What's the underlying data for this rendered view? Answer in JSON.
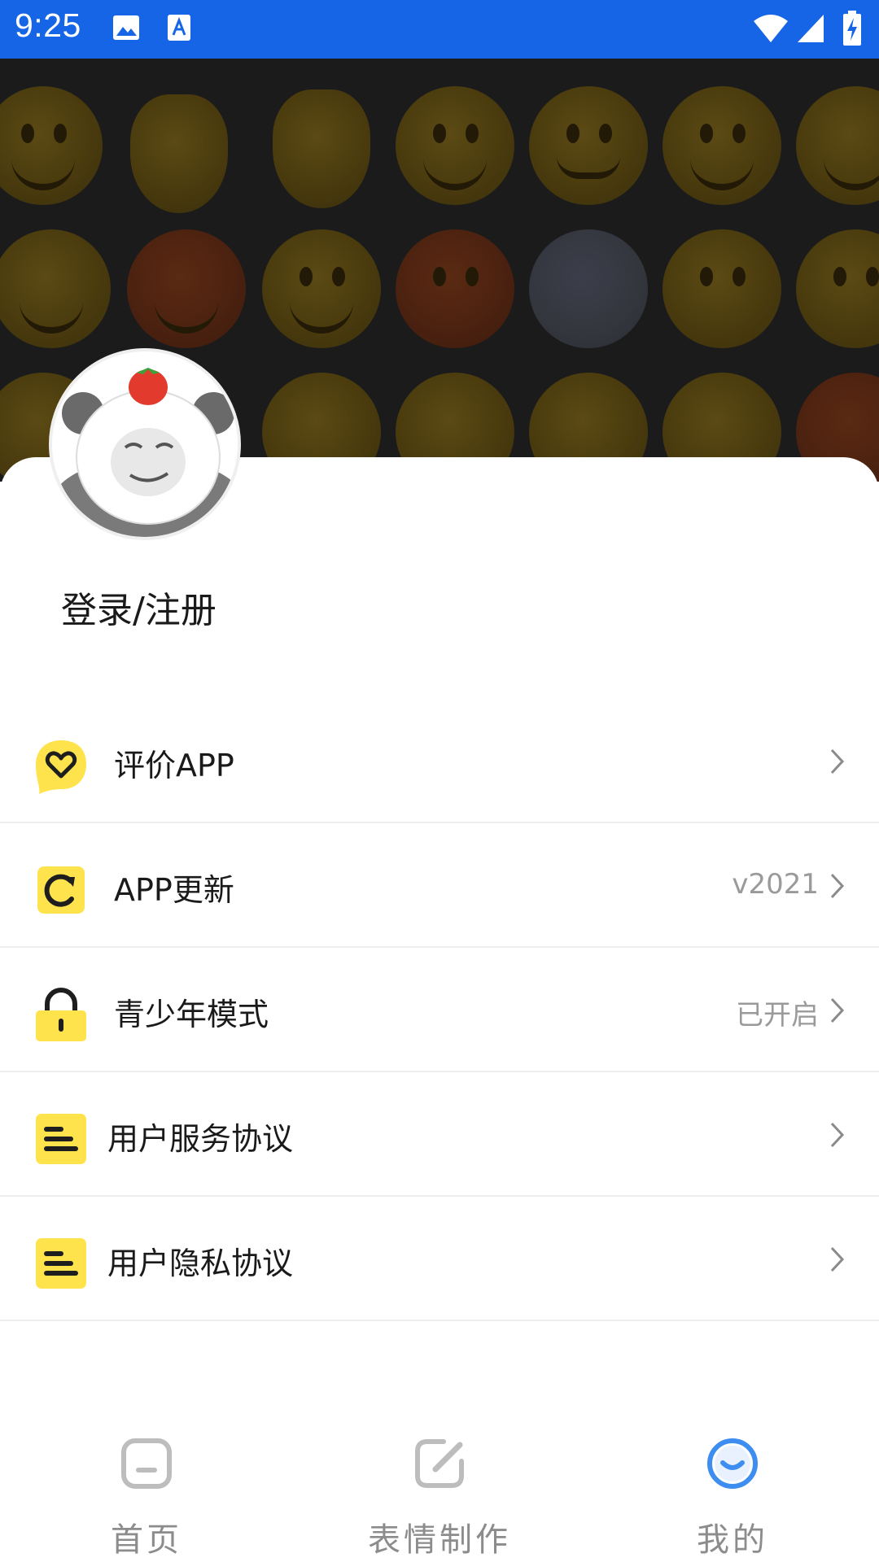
{
  "status_bar": {
    "time": "9:25"
  },
  "profile": {
    "login_label": "登录/注册"
  },
  "menu": [
    {
      "label": "评价APP",
      "value": "",
      "icon": "heart-icon"
    },
    {
      "label": "APP更新",
      "value": "v2021",
      "icon": "refresh-icon"
    },
    {
      "label": "青少年模式",
      "value": "已开启",
      "icon": "lock-icon"
    },
    {
      "label": "用户服务协议",
      "value": "",
      "icon": "document-icon"
    },
    {
      "label": "用户隐私协议",
      "value": "",
      "icon": "document-icon"
    }
  ],
  "bottom_nav": [
    {
      "label": "首页",
      "icon": "home-icon",
      "active": false
    },
    {
      "label": "表情制作",
      "icon": "edit-icon",
      "active": false
    },
    {
      "label": "我的",
      "icon": "profile-smile-icon",
      "active": true
    }
  ],
  "colors": {
    "status_bar": "#1565e6",
    "icon_yellow": "#ffe34d",
    "active_blue": "#3d8ef0",
    "inactive_gray": "#bdbdbd"
  }
}
